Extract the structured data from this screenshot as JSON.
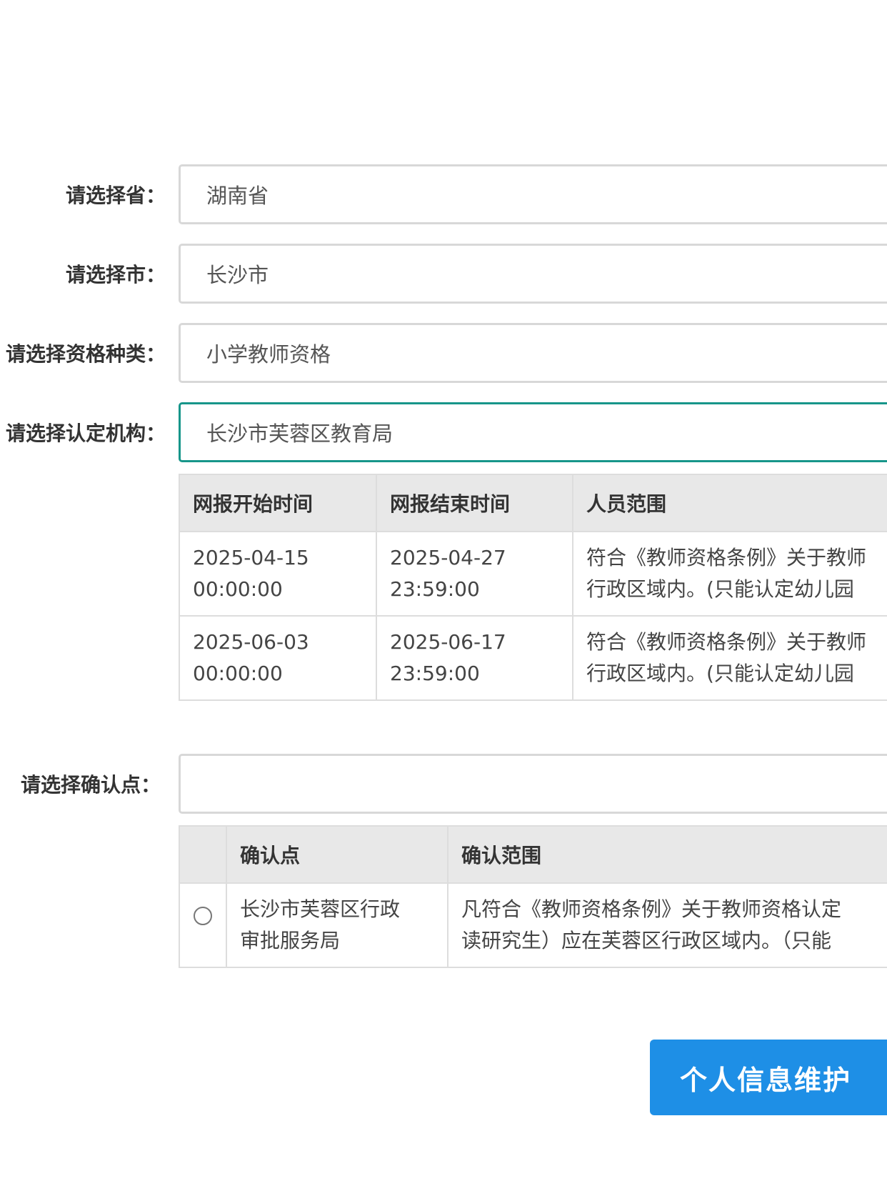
{
  "form": {
    "province": {
      "label": "请选择省：",
      "value": "湖南省"
    },
    "city": {
      "label": "请选择市：",
      "value": "长沙市"
    },
    "qualification": {
      "label": "请选择资格种类：",
      "value": "小学教师资格"
    },
    "agency": {
      "label": "请选择认定机构：",
      "value": "长沙市芙蓉区教育局"
    },
    "confirm_point": {
      "label": "请选择确认点：",
      "value": ""
    }
  },
  "schedule_table": {
    "headers": [
      "网报开始时间",
      "网报结束时间",
      "人员范围"
    ],
    "rows": [
      {
        "start_date": "2025-04-15",
        "start_time": "00:00:00",
        "end_date": "2025-04-27",
        "end_time": "23:59:00",
        "scope_line1": "符合《教师资格条例》关于教师",
        "scope_line2": "行政区域内。(只能认定幼儿园"
      },
      {
        "start_date": "2025-06-03",
        "start_time": "00:00:00",
        "end_date": "2025-06-17",
        "end_time": "23:59:00",
        "scope_line1": "符合《教师资格条例》关于教师",
        "scope_line2": "行政区域内。(只能认定幼儿园"
      }
    ]
  },
  "confirm_table": {
    "headers": [
      "",
      "确认点",
      "确认范围"
    ],
    "rows": [
      {
        "point_line1": "长沙市芙蓉区行政",
        "point_line2": "审批服务局",
        "scope_line1": "凡符合《教师资格条例》关于教师资格认定",
        "scope_line2": "读研究生）应在芙蓉区行政区域内。（只能"
      }
    ]
  },
  "actions": {
    "personal_info_button": "个人信息维护"
  }
}
